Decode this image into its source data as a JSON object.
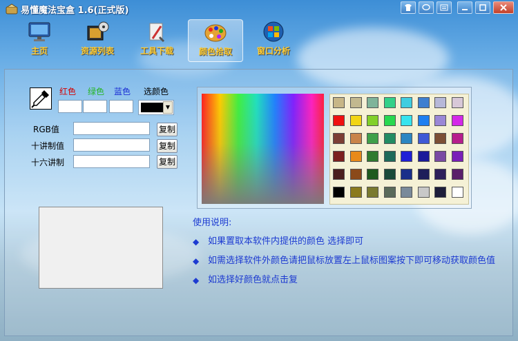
{
  "window": {
    "title": "易懂魔法宝盒 1.6(正式版)",
    "controls": [
      "shirt-icon",
      "chat-icon",
      "menu-icon",
      "minimize-icon",
      "maximize-icon",
      "close-icon"
    ]
  },
  "toolbar": {
    "items": [
      {
        "label": "主页",
        "icon": "monitor-icon"
      },
      {
        "label": "资源列表",
        "icon": "film-reel-icon"
      },
      {
        "label": "工具下载",
        "icon": "tools-icon"
      },
      {
        "label": "颜色拾取",
        "icon": "palette-icon",
        "active": true
      },
      {
        "label": "窗口分析",
        "icon": "windows-orb-icon"
      }
    ]
  },
  "picker": {
    "red_label": "红色",
    "green_label": "绿色",
    "blue_label": "蓝色",
    "select_label": "选颜色",
    "selected_color": "#000000",
    "rows": [
      {
        "label": "RGB值",
        "value": "",
        "copy_label": "复制"
      },
      {
        "label": "十讲制值",
        "value": "",
        "copy_label": "复制"
      },
      {
        "label": "十六讲制",
        "value": "",
        "copy_label": "复制"
      }
    ]
  },
  "label_colors": {
    "red": "#d40000",
    "green": "#26b526",
    "blue": "#1b2ed4"
  },
  "swatches": [
    [
      "#c7b687",
      "#c2b88f",
      "#7fb49a",
      "#33d089",
      "#3fcde0",
      "#3f7fd0",
      "#b7b8d8",
      "#d8c8d8"
    ],
    [
      "#ef1010",
      "#f2d514",
      "#82d02a",
      "#28d850",
      "#37e4ee",
      "#1e7ff0",
      "#9a87d6",
      "#d428e8"
    ],
    [
      "#7c3e35",
      "#c9844a",
      "#3fa04a",
      "#228c63",
      "#2b86c2",
      "#3f5ad6",
      "#7c4f35",
      "#b71e8d"
    ],
    [
      "#7b1f1f",
      "#e88a1a",
      "#2f7a2f",
      "#1d6a5a",
      "#1f1fd6",
      "#1b1b9a",
      "#7a4aa3",
      "#7a1fb8"
    ],
    [
      "#4a1e1e",
      "#8b4a1a",
      "#1e5a1e",
      "#1a4a3a",
      "#1a2f8a",
      "#1e1e5a",
      "#2d1f5a",
      "#5a1f6a"
    ],
    [
      "#000000",
      "#8b7a1e",
      "#7a7a30",
      "#5a6a5a",
      "#7a8a9a",
      "#c8c8c8",
      "#1e1e3a",
      "#ffffff"
    ]
  ],
  "instructions": {
    "title": "使用说明:",
    "items": [
      "如果置取本软件内提供的颜色 选择即可",
      "如需选择软件外颜色请把鼠标放置左上鼠标图案按下即可移动获取颜色值",
      "如选择好颜色就点击复"
    ]
  }
}
